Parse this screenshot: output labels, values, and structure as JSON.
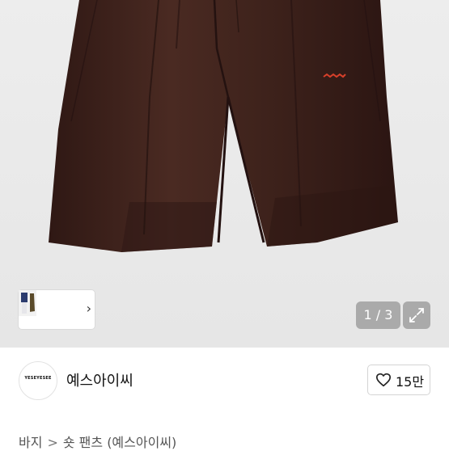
{
  "gallery": {
    "counter_text": "1 / 3",
    "thumbnail_count": 3,
    "expand_icon": "expand-icon",
    "next_icon": "chevron-right-icon",
    "product_color": "#3d211b"
  },
  "seller": {
    "name": "예스아이씨",
    "avatar_text": "YESEYESEE",
    "like_label": "15만",
    "heart_icon": "heart-icon"
  },
  "breadcrumb": {
    "items": [
      "바지",
      "숏 팬츠 (예스아이씨)"
    ],
    "separator": ">"
  }
}
